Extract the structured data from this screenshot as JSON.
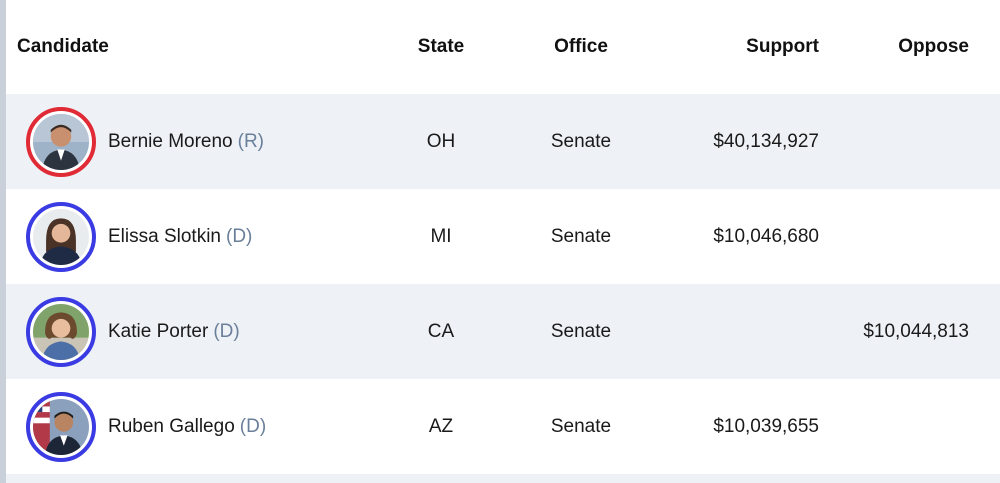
{
  "header": {
    "candidate": "Candidate",
    "state": "State",
    "office": "Office",
    "support": "Support",
    "oppose": "Oppose"
  },
  "rows": [
    {
      "name": "Bernie Moreno",
      "party": "(R)",
      "state": "OH",
      "office": "Senate",
      "support": "$40,134,927",
      "oppose": "",
      "avatar_icon": "candidate-photo",
      "ring_color": "#e02b36"
    },
    {
      "name": "Elissa Slotkin",
      "party": "(D)",
      "state": "MI",
      "office": "Senate",
      "support": "$10,046,680",
      "oppose": "",
      "avatar_icon": "candidate-photo",
      "ring_color": "#3a3be3"
    },
    {
      "name": "Katie Porter",
      "party": "(D)",
      "state": "CA",
      "office": "Senate",
      "support": "",
      "oppose": "$10,044,813",
      "avatar_icon": "candidate-photo",
      "ring_color": "#3a3be3"
    },
    {
      "name": "Ruben Gallego",
      "party": "(D)",
      "state": "AZ",
      "office": "Senate",
      "support": "$10,039,655",
      "oppose": "",
      "avatar_icon": "candidate-photo",
      "ring_color": "#3a3be3"
    }
  ]
}
